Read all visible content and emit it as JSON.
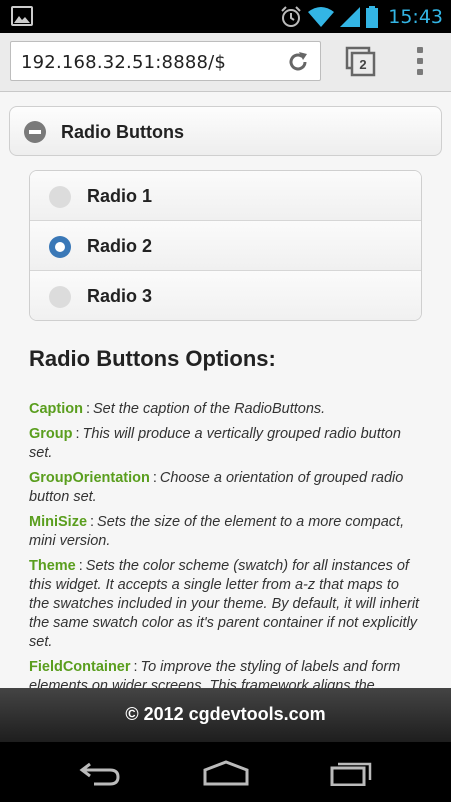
{
  "status": {
    "time": "15:43"
  },
  "browser": {
    "url": "192.168.32.51:8888/$",
    "tab_count": "2"
  },
  "collapsible": {
    "title": "Radio Buttons"
  },
  "radios": [
    {
      "label": "Radio 1",
      "checked": false
    },
    {
      "label": "Radio 2",
      "checked": true
    },
    {
      "label": "Radio 3",
      "checked": false
    }
  ],
  "options": {
    "heading": "Radio Buttons Options:",
    "separator": ":",
    "items": [
      {
        "key": "Caption",
        "desc": "Set the caption of the RadioButtons."
      },
      {
        "key": "Group",
        "desc": "This will produce a vertically grouped radio button set."
      },
      {
        "key": "GroupOrientation",
        "desc": "Choose a orientation of grouped radio button set."
      },
      {
        "key": "MiniSize",
        "desc": "Sets the size of the element to a more compact, mini version."
      },
      {
        "key": "Theme",
        "desc": "Sets the color scheme (swatch) for all instances of this widget. It accepts a single letter from a-z that maps to the swatches included in your theme. By default, it will inherit the same swatch color as it's parent container if not explicitly set."
      },
      {
        "key": "FieldContainer",
        "desc": "To improve the styling of labels and form elements on wider screens. This framework aligns the"
      }
    ]
  },
  "footer": {
    "text": "© 2012 cgdevtools.com"
  },
  "colors": {
    "accent": "#3a78b7",
    "option_key": "#5a9e1e",
    "clock": "#33b5e5"
  }
}
